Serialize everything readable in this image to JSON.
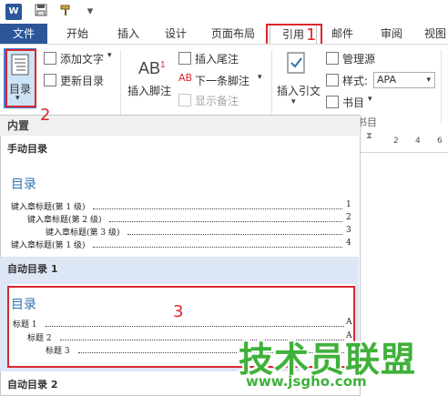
{
  "qat": {
    "word_icon": "W",
    "save_icon": "save-icon",
    "brush_icon": "format-painter-icon",
    "more_icon": "▾"
  },
  "tabs": {
    "file": "文件",
    "items": [
      "开始",
      "插入",
      "设计",
      "页面布局",
      "引用",
      "邮件",
      "审阅",
      "视图"
    ]
  },
  "ribbon": {
    "toc_button": "目录",
    "add_text": "添加文字",
    "update_toc": "更新目录",
    "insert_footnote": "插入脚注",
    "ab_label": "AB",
    "ab_sup": "1",
    "insert_endnote": "插入尾注",
    "next_footnote": "下一条脚注",
    "show_notes": "显示备注",
    "insert_citation": "插入引文",
    "manage_sources": "管理源",
    "style_label": "样式:",
    "style_value": "APA",
    "bibliography": "书目",
    "group_label": "书目",
    "ruler_marks": [
      "2",
      "4",
      "6"
    ]
  },
  "annotations": {
    "n1": "1",
    "n2": "2",
    "n3": "3"
  },
  "gallery": {
    "builtin": "内置",
    "manual_title": "手动目录",
    "manual_preview": {
      "heading": "目录",
      "lines": [
        {
          "text": "键入章标题(第 1 级)",
          "page": "1"
        },
        {
          "text": "键入章标题(第 2 级)",
          "page": "2"
        },
        {
          "text": "键入章标题(第 3 级)",
          "page": "3"
        },
        {
          "text": "键入章标题(第 1 级)",
          "page": "4"
        }
      ]
    },
    "auto1_title": "自动目录 1",
    "auto1_preview": {
      "heading": "目录",
      "lines": [
        {
          "text": "标题 1",
          "page": "A"
        },
        {
          "text": "标题 2",
          "page": "A"
        },
        {
          "text": "标题 3",
          "page": "A"
        }
      ]
    },
    "auto2_title": "自动目录 2"
  },
  "watermark": {
    "brand": "技术员联盟",
    "url": "www.jsgho.com"
  },
  "colors": {
    "accent_blue": "#2b579a",
    "highlight": "#d9272e",
    "watermark_green": "#3fb13a"
  }
}
